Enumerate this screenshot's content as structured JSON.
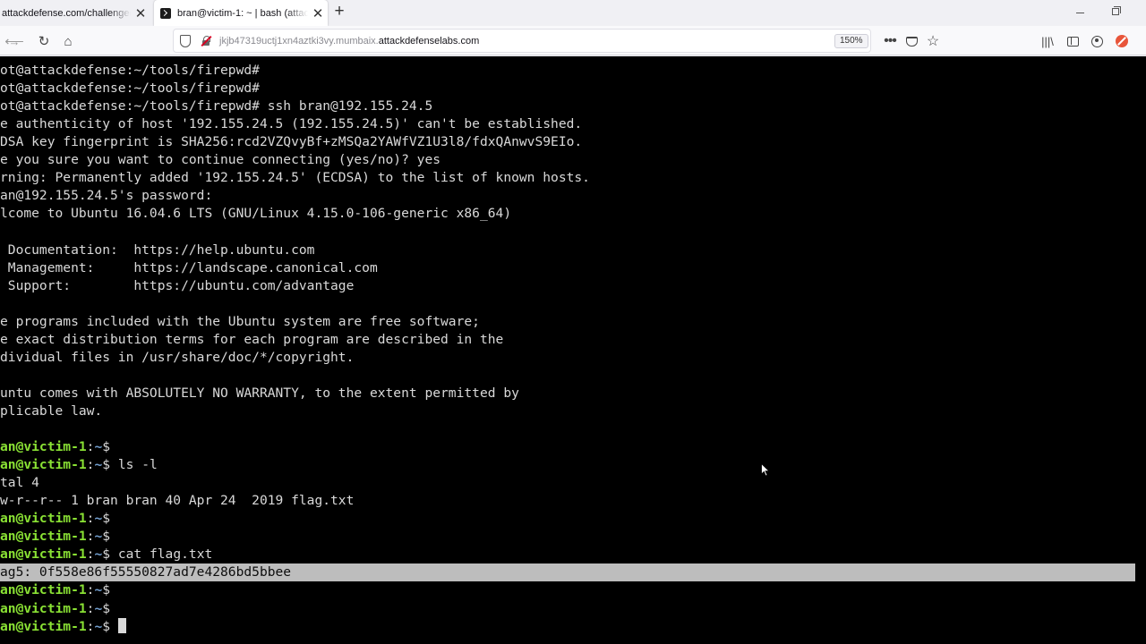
{
  "browser": {
    "tabs": [
      {
        "title": "attackdefense.com/challengedetails?cid=..."
      },
      {
        "title": "bran@victim-1: ~ | bash (attackdefense)"
      }
    ],
    "url_prefix": "jkjb47319uctj1xn4aztki3vy.mumbaix.",
    "url_domain": "attackdefenselabs.com",
    "zoom": "150%",
    "icons": [
      "back-icon",
      "forward-icon",
      "reload-icon",
      "home-icon",
      "shield-icon",
      "lock-insecure-icon",
      "more-icon",
      "pocket-icon",
      "bookmark-star-icon",
      "library-icon",
      "sidebar-icon",
      "account-icon",
      "extension-icon"
    ]
  },
  "terminal": {
    "colors": {
      "background": "#000000",
      "text": "#d9d9d9",
      "prompt_user": "#8ae234",
      "prompt_path": "#729fcf",
      "highlight": "#bdbdbd"
    },
    "lines": [
      {
        "text": "ot@attackdefense:~/tools/firepwd#"
      },
      {
        "text": "ot@attackdefense:~/tools/firepwd#"
      },
      {
        "text": "ot@attackdefense:~/tools/firepwd# ssh bran@192.155.24.5"
      },
      {
        "text": "e authenticity of host '192.155.24.5 (192.155.24.5)' can't be established."
      },
      {
        "text": "DSA key fingerprint is SHA256:rcd2VZQvyBf+zMSQa2YAWfVZ1U3l8/fdxQAnwvS9EIo."
      },
      {
        "text": "e you sure you want to continue connecting (yes/no)? yes"
      },
      {
        "text": "rning: Permanently added '192.155.24.5' (ECDSA) to the list of known hosts."
      },
      {
        "text": "an@192.155.24.5's password:"
      },
      {
        "text": "lcome to Ubuntu 16.04.6 LTS (GNU/Linux 4.15.0-106-generic x86_64)"
      },
      {
        "text": ""
      },
      {
        "text": " Documentation:  https://help.ubuntu.com"
      },
      {
        "text": " Management:     https://landscape.canonical.com"
      },
      {
        "text": " Support:        https://ubuntu.com/advantage"
      },
      {
        "text": ""
      },
      {
        "text": "e programs included with the Ubuntu system are free software;"
      },
      {
        "text": "e exact distribution terms for each program are described in the"
      },
      {
        "text": "dividual files in /usr/share/doc/*/copyright."
      },
      {
        "text": ""
      },
      {
        "text": "untu comes with ABSOLUTELY NO WARRANTY, to the extent permitted by"
      },
      {
        "text": "plicable law."
      },
      {
        "text": ""
      },
      {
        "prompt": {
          "user": "an@victim-1",
          "sep": ":",
          "path": "~",
          "symbol": "$"
        },
        "cmd": ""
      },
      {
        "prompt": {
          "user": "an@victim-1",
          "sep": ":",
          "path": "~",
          "symbol": "$"
        },
        "cmd": " ls -l"
      },
      {
        "text": "tal 4"
      },
      {
        "text": "w-r--r-- 1 bran bran 40 Apr 24  2019 flag.txt"
      },
      {
        "prompt": {
          "user": "an@victim-1",
          "sep": ":",
          "path": "~",
          "symbol": "$"
        },
        "cmd": ""
      },
      {
        "prompt": {
          "user": "an@victim-1",
          "sep": ":",
          "path": "~",
          "symbol": "$"
        },
        "cmd": ""
      },
      {
        "prompt": {
          "user": "an@victim-1",
          "sep": ":",
          "path": "~",
          "symbol": "$"
        },
        "cmd": " cat flag.txt"
      },
      {
        "text": "ag5: 0f558e86f55550827ad7e4286bd5bbee",
        "highlighted": true
      },
      {
        "prompt": {
          "user": "an@victim-1",
          "sep": ":",
          "path": "~",
          "symbol": "$"
        },
        "cmd": ""
      },
      {
        "prompt": {
          "user": "an@victim-1",
          "sep": ":",
          "path": "~",
          "symbol": "$"
        },
        "cmd": ""
      },
      {
        "prompt": {
          "user": "an@victim-1",
          "sep": ":",
          "path": "~",
          "symbol": "$"
        },
        "cmd": " ",
        "cursor": true
      }
    ]
  }
}
